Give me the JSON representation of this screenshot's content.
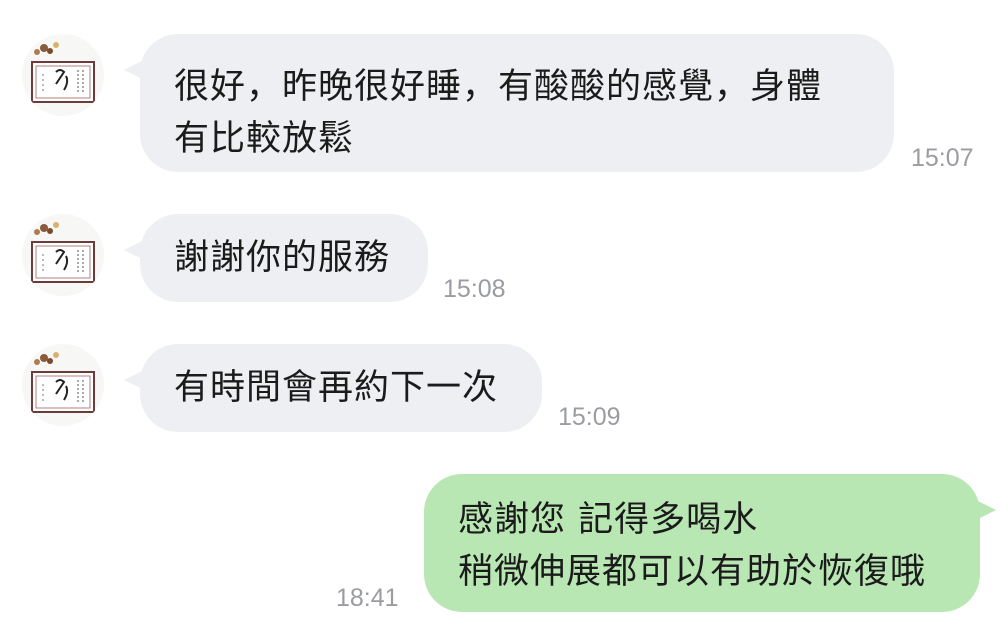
{
  "colors": {
    "incoming_bubble": "#eeeff3",
    "outgoing_bubble": "#b9e7b3",
    "timestamp": "#9a9ca2",
    "text": "#1b1b1b"
  },
  "messages": [
    {
      "direction": "incoming",
      "avatar_icon": "calligraphy-art-avatar-icon",
      "text": "很好，昨晚很好睡，有酸酸的感覺，身體\n有比較放鬆",
      "time": "15:07"
    },
    {
      "direction": "incoming",
      "avatar_icon": "calligraphy-art-avatar-icon",
      "text": "謝謝你的服務",
      "time": "15:08"
    },
    {
      "direction": "incoming",
      "avatar_icon": "calligraphy-art-avatar-icon",
      "text": "有時間會再約下一次",
      "time": "15:09"
    },
    {
      "direction": "outgoing",
      "text": "感謝您 記得多喝水\n稍微伸展都可以有助於恢復哦",
      "time": "18:41"
    }
  ]
}
